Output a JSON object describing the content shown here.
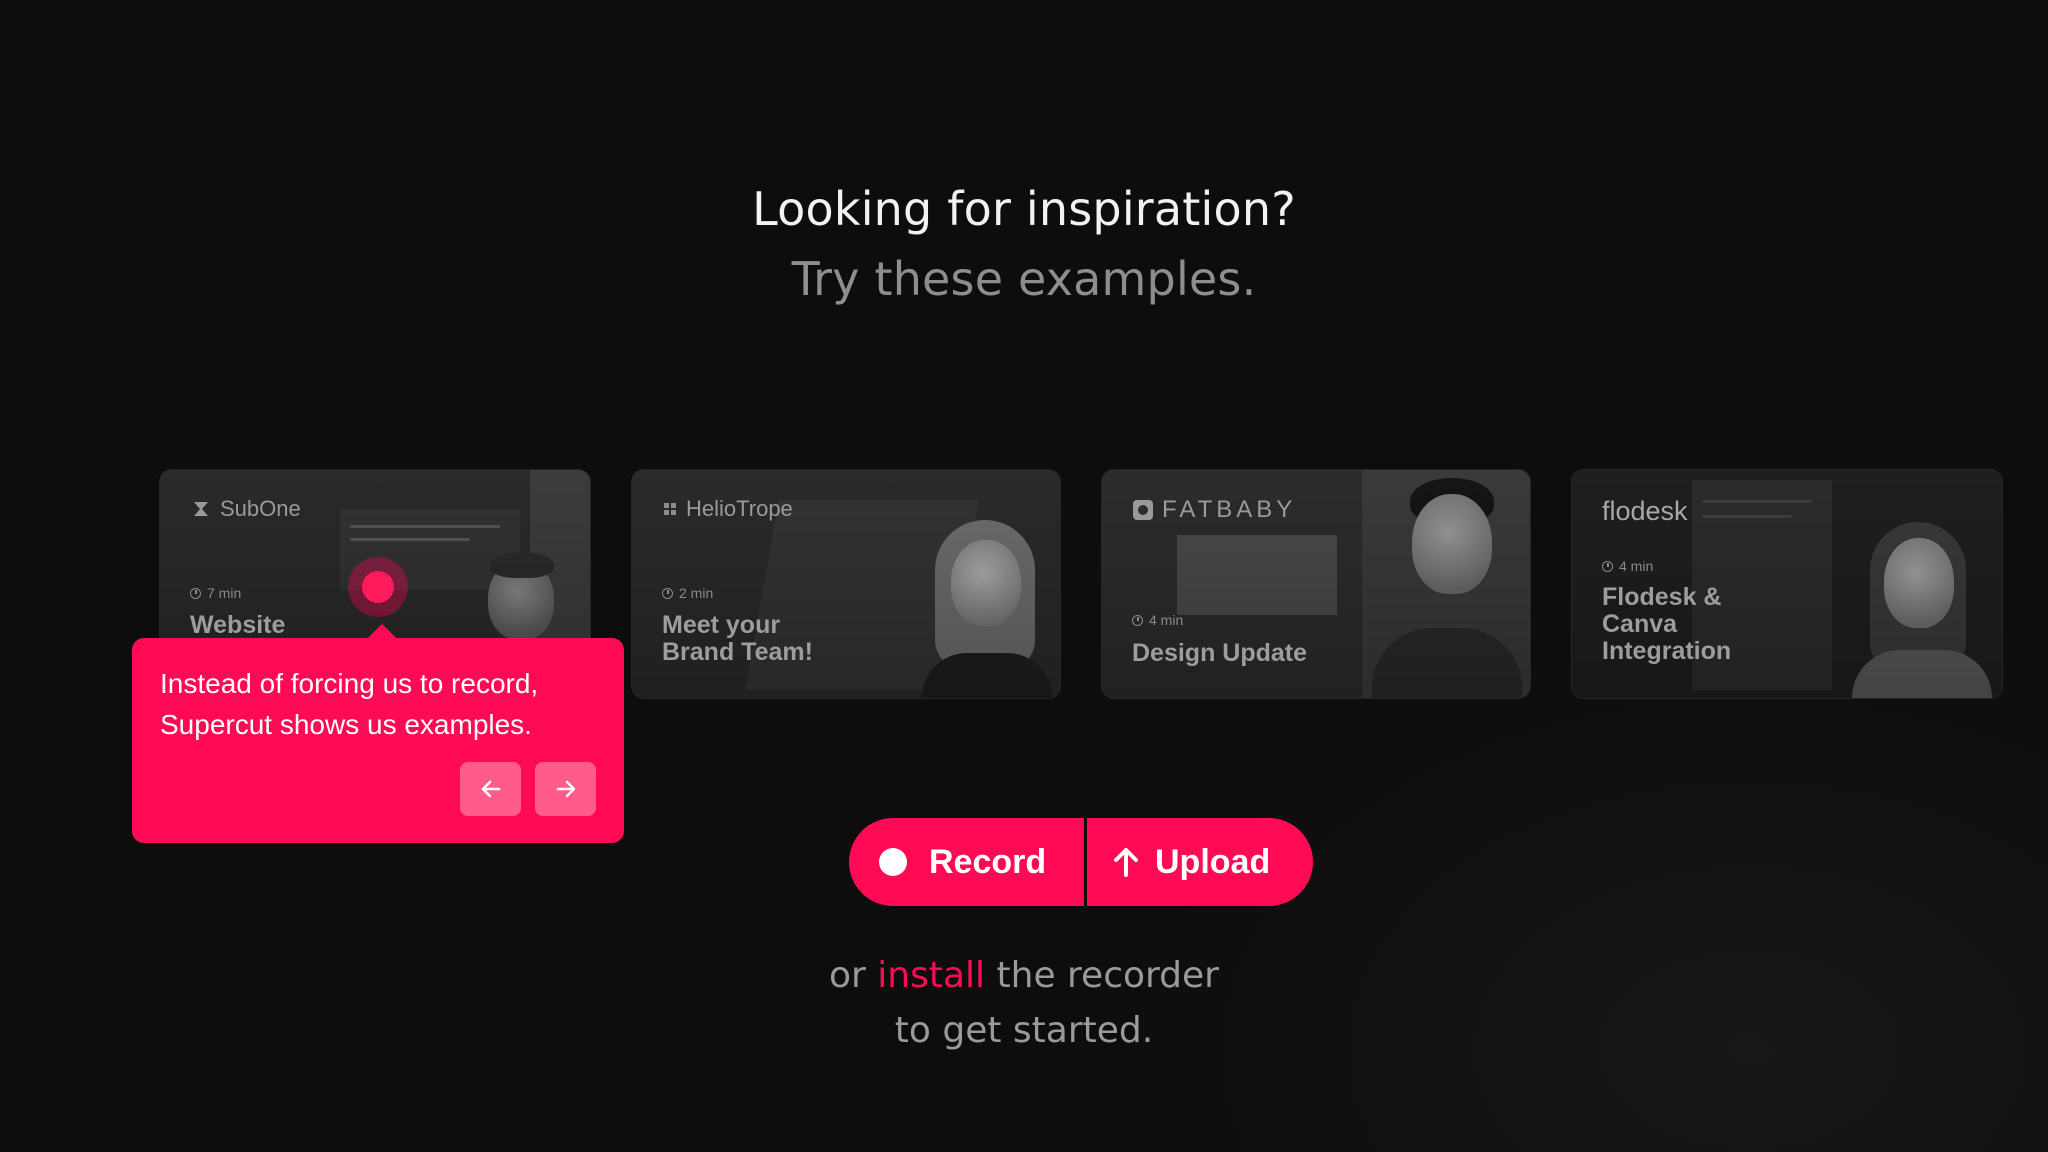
{
  "headline": {
    "line1": "Looking for inspiration?",
    "line2": "Try these examples."
  },
  "examples": [
    {
      "brand": "SubOne",
      "duration": "7 min",
      "title": "Website",
      "brand_icon": "subone-logo-icon"
    },
    {
      "brand": "HelioTrope",
      "duration": "2 min",
      "title": "Meet your\nBrand Team!",
      "brand_icon": "heliotrope-logo-icon"
    },
    {
      "brand": "FATBABY",
      "duration": "4 min",
      "title": "Design Update",
      "brand_icon": "fatbaby-logo-icon"
    },
    {
      "brand": "flodesk",
      "duration": "4 min",
      "title": "Flodesk &\nCanva\nIntegration",
      "brand_icon": ""
    }
  ],
  "tooltip": {
    "message": "Instead of forcing us to record,\nSupercut shows us examples.",
    "prev_icon": "arrow-left-icon",
    "next_icon": "arrow-right-icon"
  },
  "cta": {
    "record_label": "Record",
    "upload_label": "Upload"
  },
  "footer": {
    "prefix": "or ",
    "link": "install",
    "suffix": " the recorder",
    "line2": "to get started."
  },
  "colors": {
    "accent": "#ff0a54",
    "background": "#0d0d0e",
    "headline": "#f2f2f2",
    "muted": "#8e8e8e"
  }
}
